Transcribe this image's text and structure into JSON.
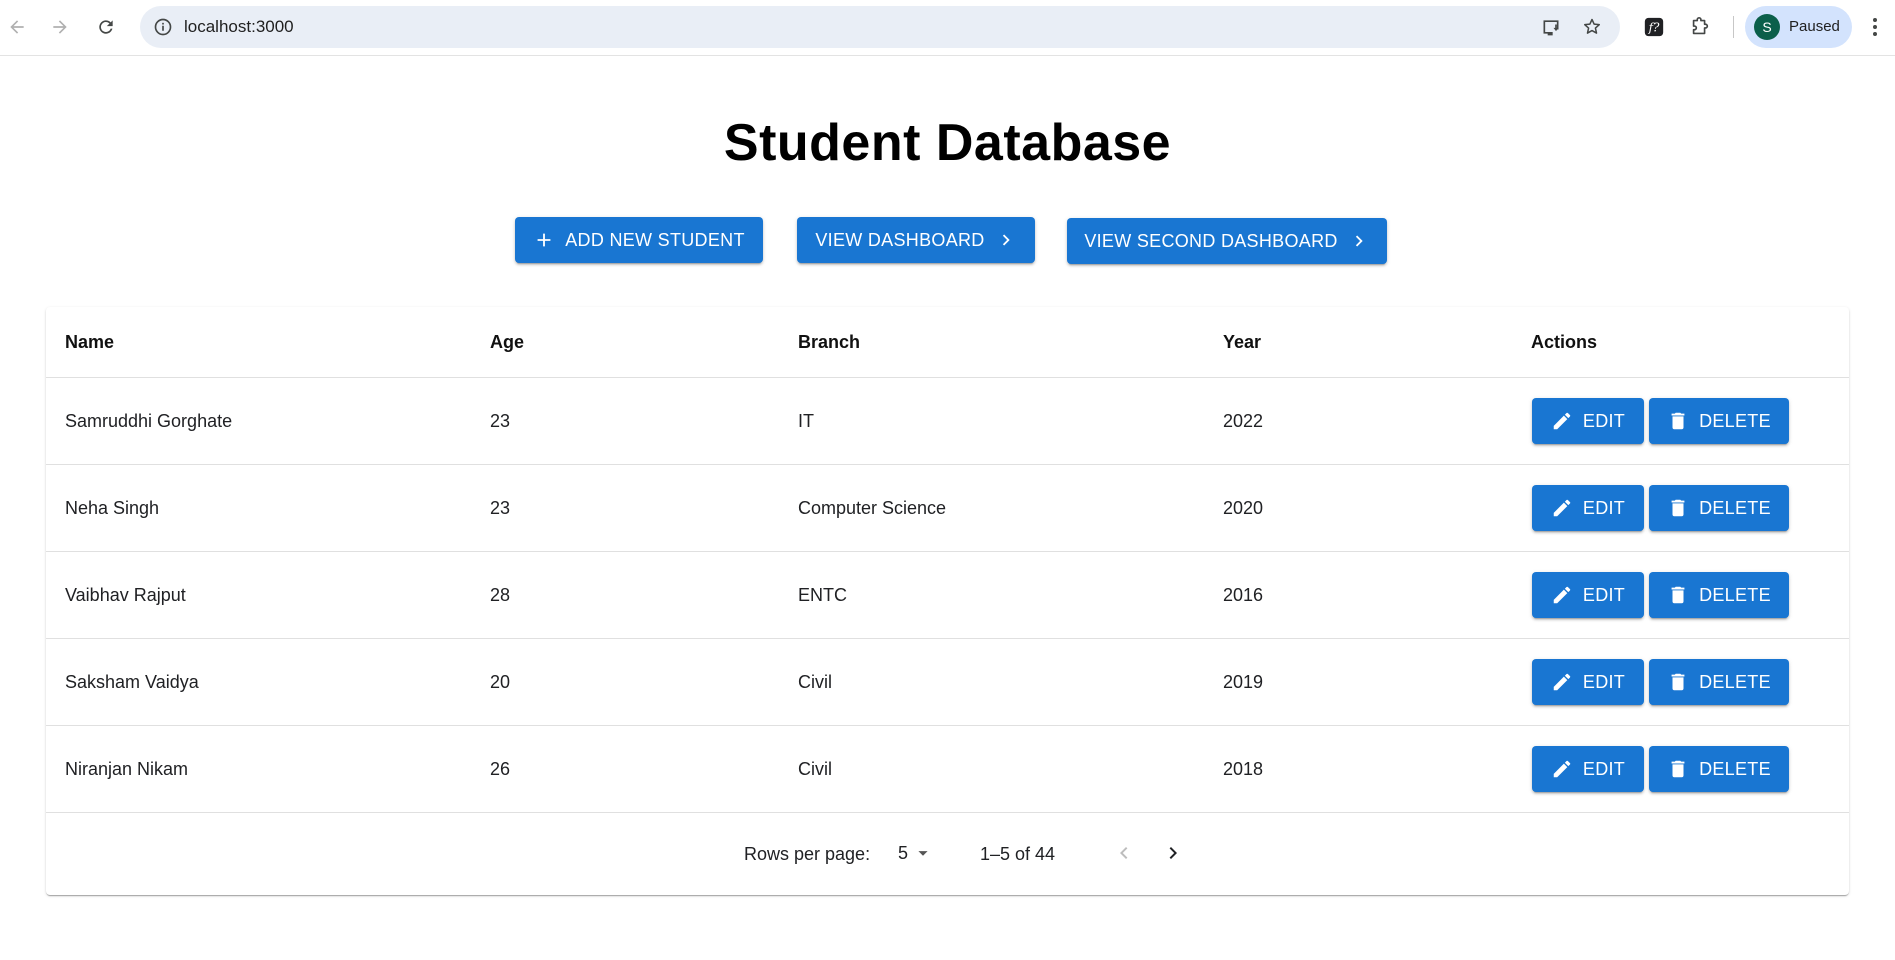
{
  "browser": {
    "url": "localhost:3000",
    "profile_initial": "S",
    "profile_status": "Paused"
  },
  "page": {
    "title": "Student Database",
    "add_button": "ADD NEW STUDENT",
    "dashboard_button": "VIEW DASHBOARD",
    "second_dashboard_button": "VIEW SECOND DASHBOARD"
  },
  "table": {
    "columns": [
      "Name",
      "Age",
      "Branch",
      "Year",
      "Actions"
    ],
    "rows": [
      {
        "name": "Samruddhi Gorghate",
        "age": "23",
        "branch": "IT",
        "year": "2022"
      },
      {
        "name": "Neha Singh",
        "age": "23",
        "branch": "Computer Science",
        "year": "2020"
      },
      {
        "name": "Vaibhav Rajput",
        "age": "28",
        "branch": "ENTC",
        "year": "2016"
      },
      {
        "name": "Saksham Vaidya",
        "age": "20",
        "branch": "Civil",
        "year": "2019"
      },
      {
        "name": "Niranjan Nikam",
        "age": "26",
        "branch": "Civil",
        "year": "2018"
      }
    ],
    "edit_label": "EDIT",
    "delete_label": "DELETE"
  },
  "pagination": {
    "rows_per_page_label": "Rows per page:",
    "rows_per_page_value": "5",
    "range_text": "1–5 of 44"
  },
  "colors": {
    "primary": "#1976d2",
    "omnibox_bg": "#e9eef6",
    "profile_bg": "#d3e3fd"
  },
  "icons": [
    "back-icon",
    "forward-icon",
    "reload-icon",
    "site-info-icon",
    "install-app-icon",
    "bookmark-star-icon",
    "formula-extension-icon",
    "extensions-puzzle-icon",
    "more-menu-icon",
    "plus-icon",
    "chevron-right-icon",
    "pencil-icon",
    "trash-icon",
    "dropdown-arrow-icon",
    "chevron-left-icon"
  ]
}
